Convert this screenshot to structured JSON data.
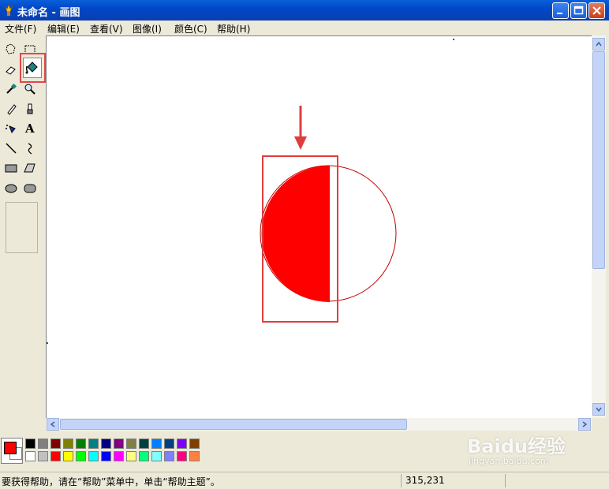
{
  "window": {
    "title": "未命名 - 画图",
    "min_icon": "minimize-icon",
    "max_icon": "maximize-icon",
    "close_icon": "close-icon"
  },
  "menu": [
    {
      "label": "文件(F)"
    },
    {
      "label": "编辑(E)"
    },
    {
      "label": "查看(V)"
    },
    {
      "label": "图像(I)"
    },
    {
      "label": "颜色(C)"
    },
    {
      "label": "帮助(H)"
    }
  ],
  "tools": [
    {
      "name": "free-form-select-icon"
    },
    {
      "name": "rect-select-icon"
    },
    {
      "name": "eraser-icon"
    },
    {
      "name": "fill-bucket-icon",
      "selected": true
    },
    {
      "name": "color-picker-icon"
    },
    {
      "name": "magnifier-icon"
    },
    {
      "name": "pencil-icon"
    },
    {
      "name": "brush-icon"
    },
    {
      "name": "airbrush-icon"
    },
    {
      "name": "text-icon",
      "label": "A"
    },
    {
      "name": "line-icon"
    },
    {
      "name": "curve-icon"
    },
    {
      "name": "rectangle-icon"
    },
    {
      "name": "polygon-icon"
    },
    {
      "name": "ellipse-icon"
    },
    {
      "name": "rounded-rect-icon"
    }
  ],
  "canvas": {
    "shape_fill": "#ff0000",
    "outline_color": "#c00000",
    "annotation_color": "#e03c3c"
  },
  "palette": {
    "foreground": "#ff0000",
    "background": "#ffffff",
    "row1": [
      "#000000",
      "#808080",
      "#800000",
      "#808000",
      "#008000",
      "#008080",
      "#000080",
      "#800080",
      "#808040",
      "#004040",
      "#0080ff",
      "#004080",
      "#8000ff",
      "#804000"
    ],
    "row2": [
      "#ffffff",
      "#c0c0c0",
      "#ff0000",
      "#ffff00",
      "#00ff00",
      "#00ffff",
      "#0000ff",
      "#ff00ff",
      "#ffff80",
      "#00ff80",
      "#80ffff",
      "#8080ff",
      "#ff0080",
      "#ff8040"
    ]
  },
  "status": {
    "help_text": "要获得帮助，请在“帮助”菜单中，单击“帮助主题”。",
    "coords": "315,231"
  },
  "watermark": {
    "main": "Baidu经验",
    "sub": "jingyan.baidu.com"
  }
}
